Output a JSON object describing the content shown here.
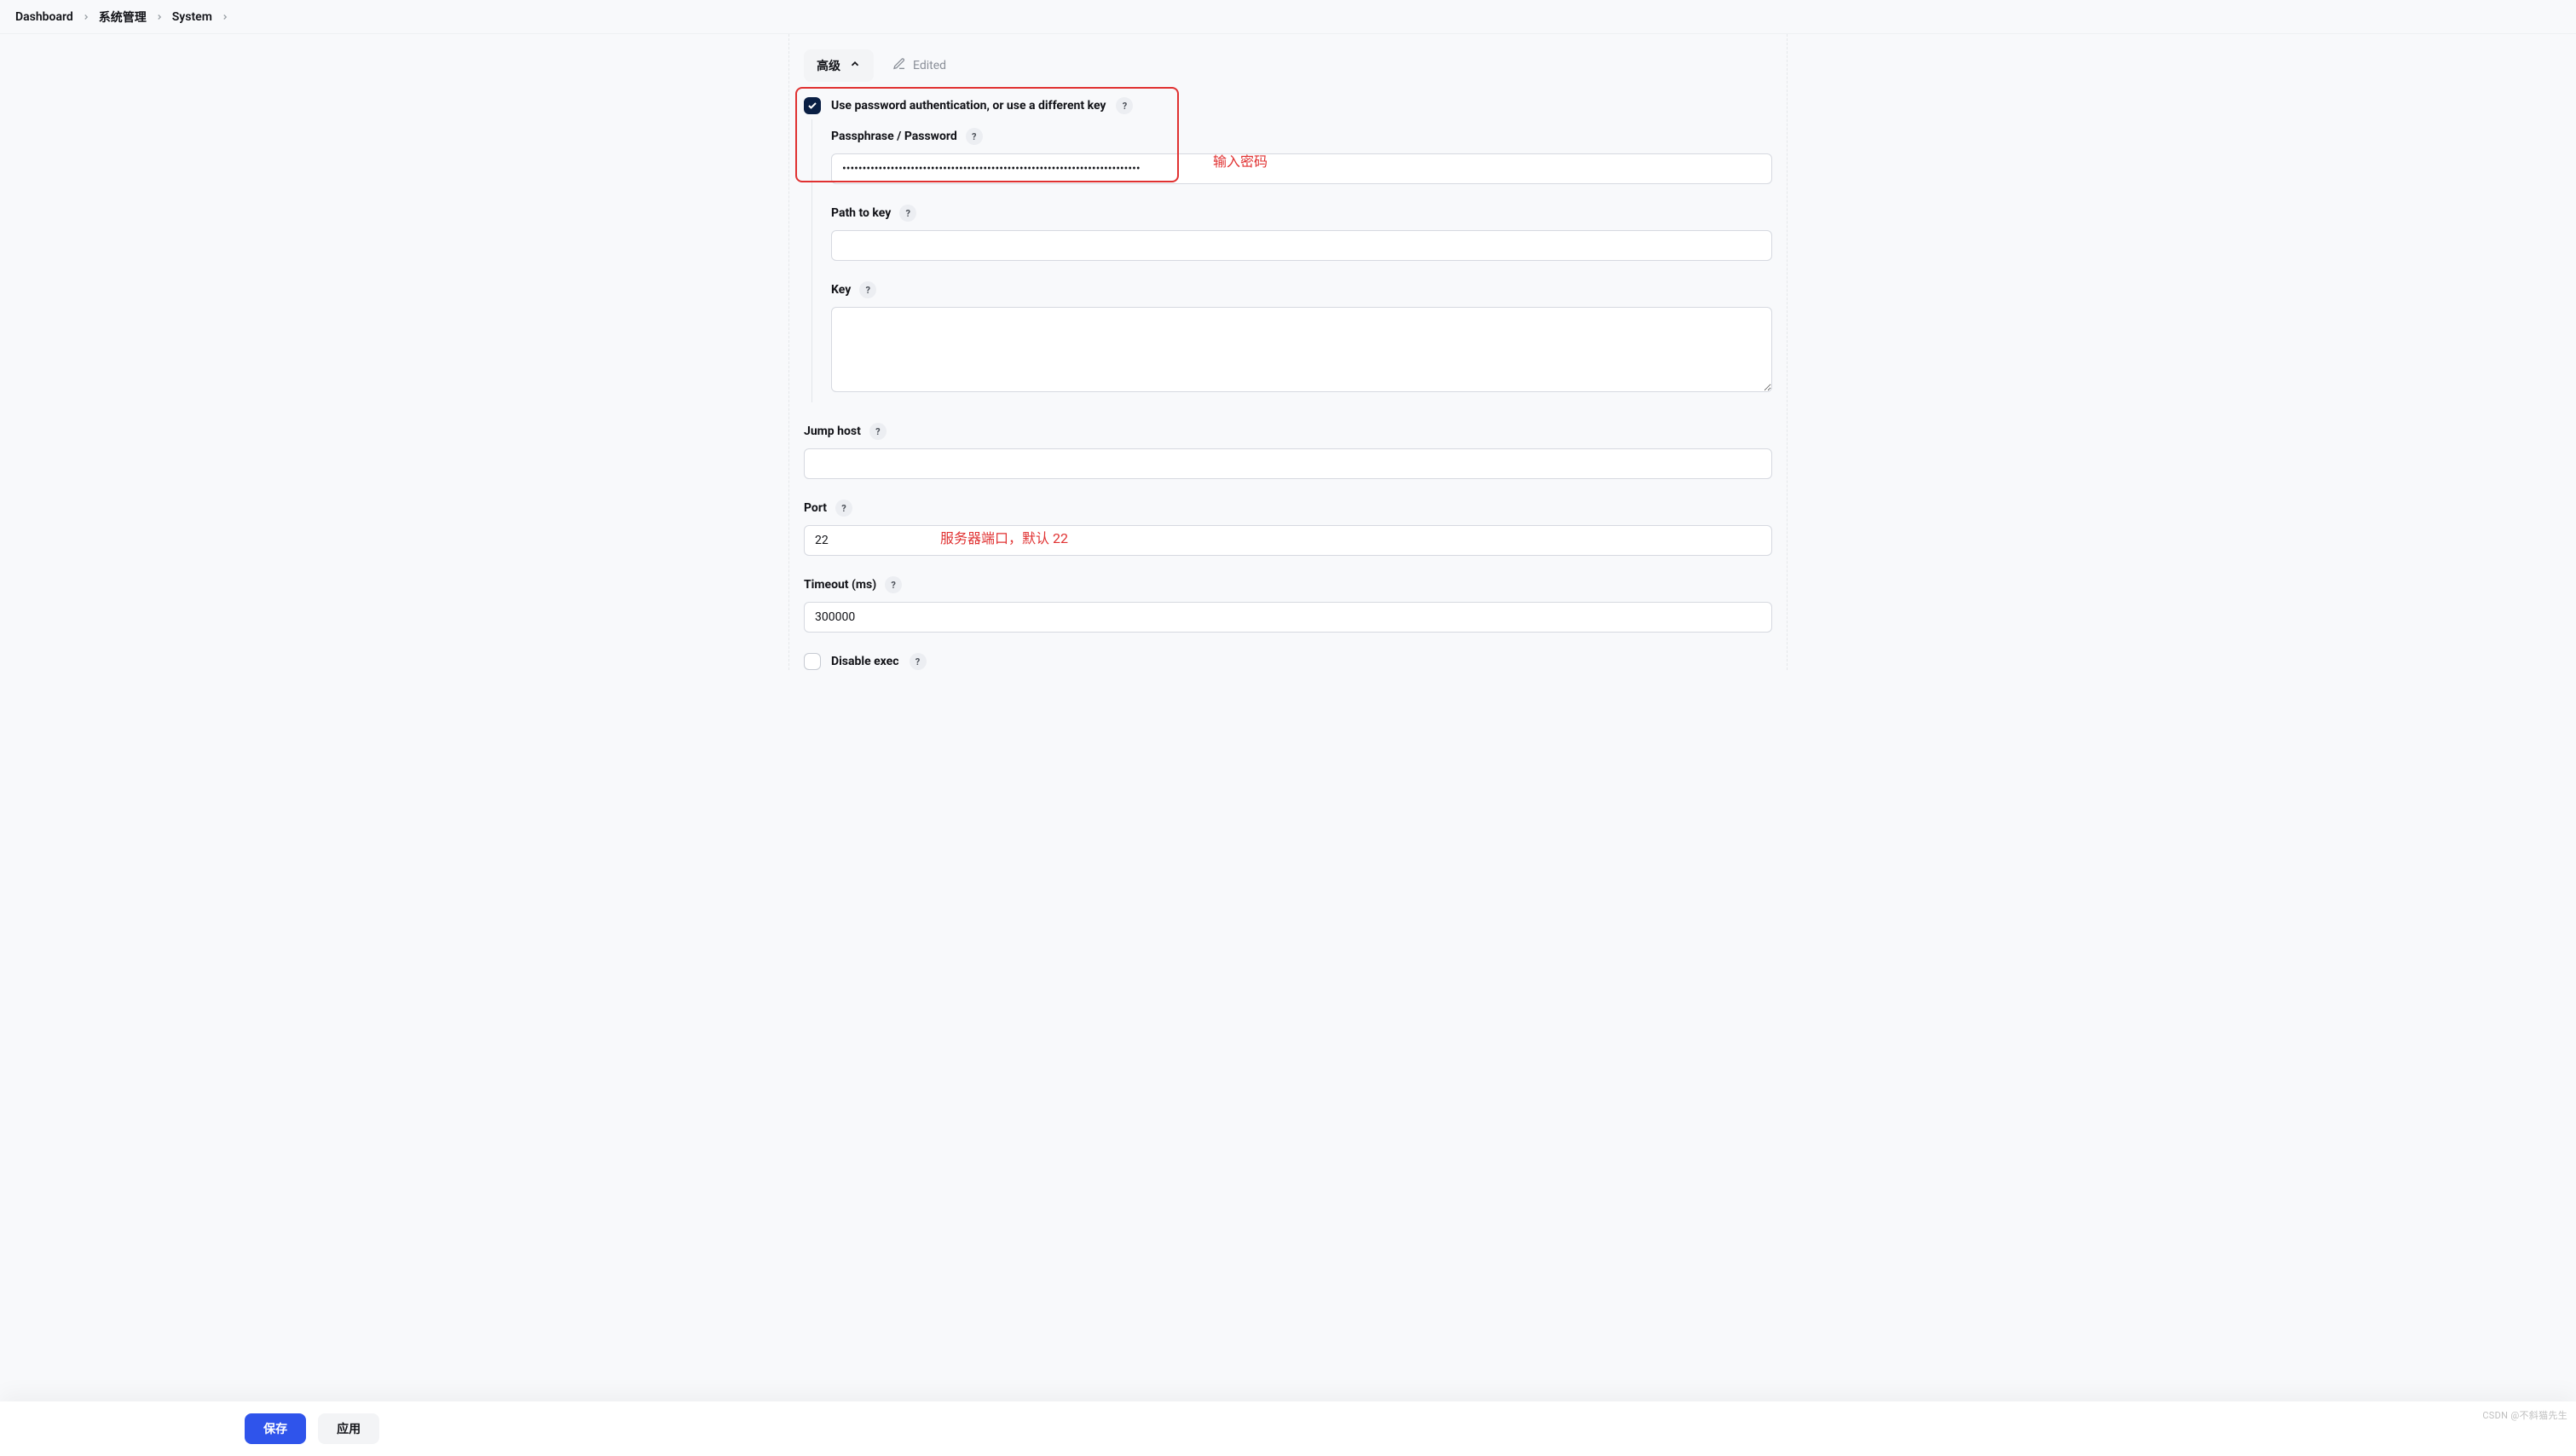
{
  "breadcrumb": {
    "items": [
      "Dashboard",
      "系统管理",
      "System"
    ]
  },
  "section": {
    "toggle_label": "高级",
    "edited_label": "Edited"
  },
  "form": {
    "use_password_auth": {
      "label": "Use password authentication, or use a different key",
      "checked": true
    },
    "passphrase": {
      "label": "Passphrase / Password",
      "value": "••••••••••••••••••••••••••••••••••••••••••••••••••••••••••••••••••••••••••"
    },
    "path_to_key": {
      "label": "Path to key",
      "value": ""
    },
    "key": {
      "label": "Key",
      "value": ""
    },
    "jump_host": {
      "label": "Jump host",
      "value": ""
    },
    "port": {
      "label": "Port",
      "value": "22"
    },
    "timeout": {
      "label": "Timeout (ms)",
      "value": "300000"
    },
    "disable_exec": {
      "label": "Disable exec",
      "checked": false
    }
  },
  "annotations": {
    "password_hint": "输入密码",
    "port_hint": "服务器端口，默认 22"
  },
  "footer": {
    "save_label": "保存",
    "apply_label": "应用"
  },
  "help_mark": "?",
  "watermark": "CSDN @不斜猫先生"
}
